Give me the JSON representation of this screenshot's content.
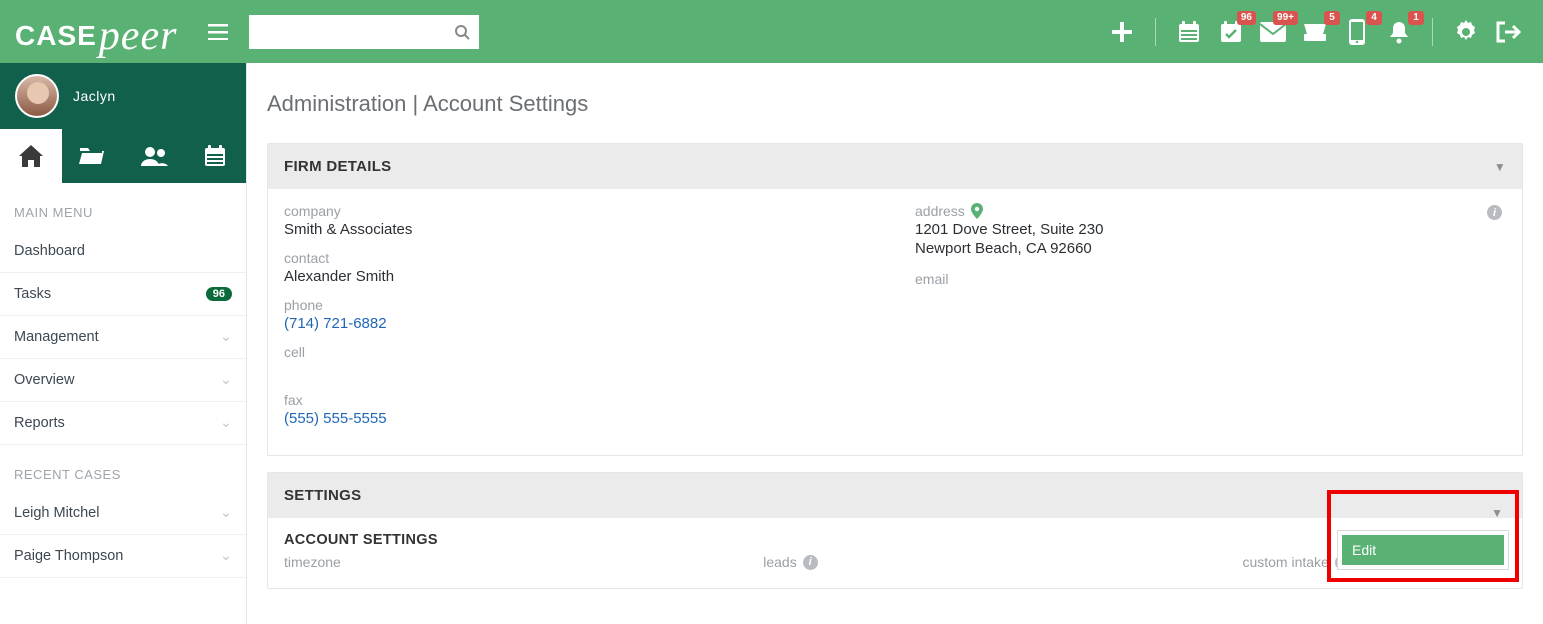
{
  "brand": {
    "part1": "CASE",
    "part2": "peer"
  },
  "topbar": {
    "badges": {
      "calendarCheck": "96",
      "mail": "99+",
      "inbox": "5",
      "phone": "4",
      "bell": "1"
    }
  },
  "user": {
    "name": "Jaclyn"
  },
  "sidebar": {
    "section1": "MAIN MENU",
    "items": [
      {
        "label": "Dashboard"
      },
      {
        "label": "Tasks",
        "badge": "96"
      },
      {
        "label": "Management",
        "chevron": true
      },
      {
        "label": "Overview",
        "chevron": true
      },
      {
        "label": "Reports",
        "chevron": true
      }
    ],
    "section2": "RECENT CASES",
    "cases": [
      {
        "label": "Leigh Mitchel"
      },
      {
        "label": "Paige Thompson"
      }
    ]
  },
  "page": {
    "title": "Administration | Account Settings"
  },
  "firm": {
    "heading": "FIRM DETAILS",
    "companyLabel": "company",
    "company": "Smith & Associates",
    "contactLabel": "contact",
    "contact": "Alexander Smith",
    "phoneLabel": "phone",
    "phone": "(714) 721-6882",
    "cellLabel": "cell",
    "cell": "",
    "faxLabel": "fax",
    "fax": "(555) 555-5555",
    "addressLabel": "address",
    "addressLine1": "1201 Dove Street, Suite 230",
    "addressLine2": "Newport Beach, CA 92660",
    "emailLabel": "email"
  },
  "settings": {
    "heading": "SETTINGS",
    "subheading": "ACCOUNT SETTINGS",
    "timezoneLabel": "timezone",
    "leadsLabel": "leads",
    "customIntakeLabel": "custom intake",
    "editLabel": "Edit"
  }
}
